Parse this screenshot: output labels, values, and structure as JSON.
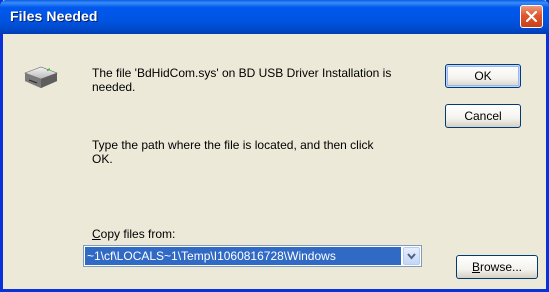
{
  "window": {
    "title": "Files Needed"
  },
  "message": {
    "line1": "The file 'BdHidCom.sys' on BD USB Driver Installation is",
    "line2": "needed.",
    "instruction_line1": "Type the path where the file is located, and then click",
    "instruction_line2": "OK."
  },
  "copy_from": {
    "label_accel": "C",
    "label_rest": "opy files from:",
    "value": "~1\\cf\\LOCALS~1\\Temp\\I1060816728\\Windows"
  },
  "buttons": {
    "ok": "OK",
    "cancel": "Cancel",
    "browse_accel": "B",
    "browse_rest": "rowse..."
  },
  "icons": {
    "disk": "disk-drive-icon",
    "close": "close-icon",
    "dropdown": "chevron-down-icon"
  },
  "colors": {
    "title_bar": "#0054e3",
    "close_button": "#e0562c",
    "selection": "#316ac5",
    "dialog_face": "#ece9d8"
  }
}
